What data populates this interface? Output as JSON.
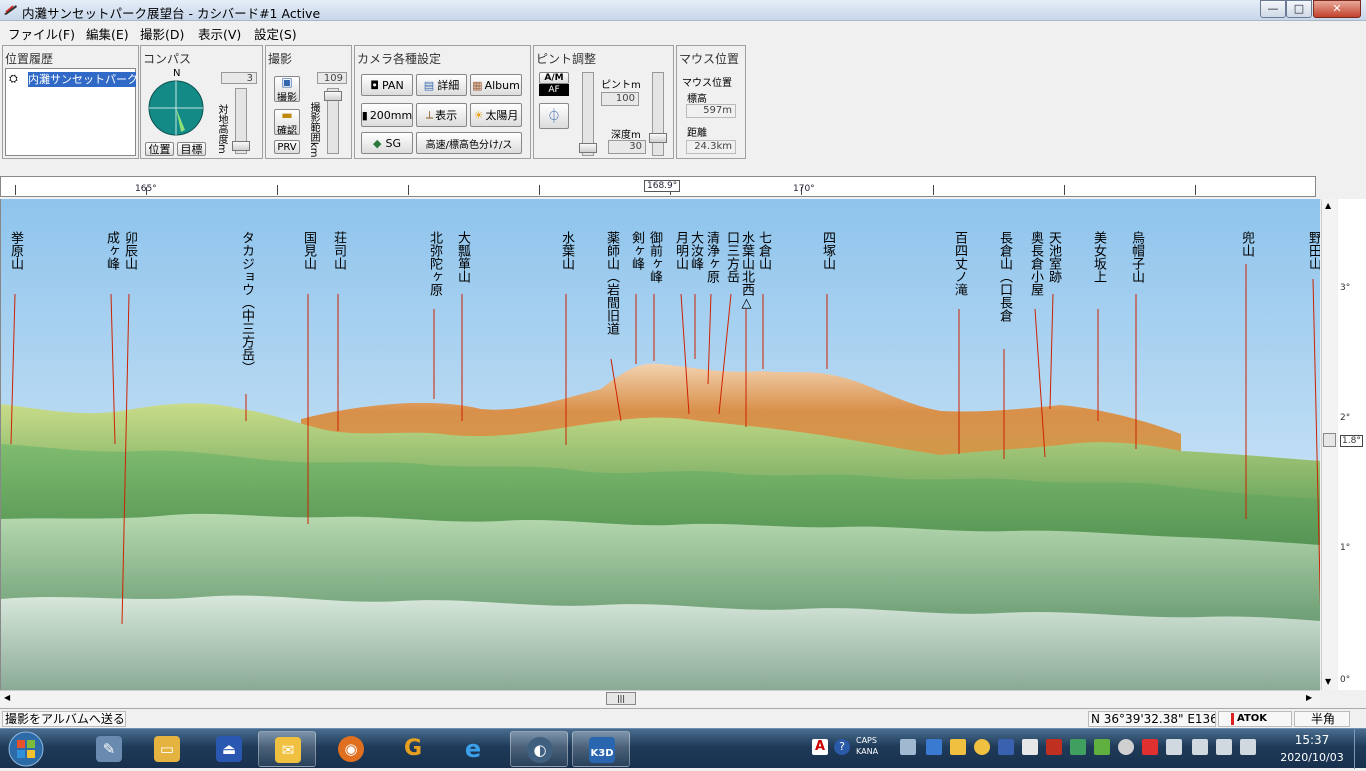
{
  "window": {
    "title": "内灘サンセットパーク展望台 - カシバード#1 Active",
    "min": "—",
    "max": "□",
    "close": "✕"
  },
  "menus": [
    "ファイル(F)",
    "編集(E)",
    "撮影(D)",
    "表示(V)",
    "設定(S)"
  ],
  "panels": {
    "history": {
      "title": "位置履歴",
      "item": "内灘サンセットパーク展"
    },
    "compass": {
      "title": "コンパス",
      "north": "N",
      "height_value": "3",
      "height_label": "対地高度m",
      "pos_button": "位置",
      "target_button": "目標"
    },
    "shoot": {
      "title": "撮影",
      "shoot_button": "撮影",
      "confirm_button": "確認",
      "prv_button": "PRV",
      "range_value": "109",
      "range_label": "撮影範囲km"
    },
    "camera": {
      "title": "カメラ各種設定",
      "buttons": [
        "PAN",
        "詳細",
        "Album",
        "200mm",
        "表示",
        "太陽月",
        "SG",
        "高速/標高色分け/ス"
      ]
    },
    "focus": {
      "title": "ピント調整",
      "am": "A/M",
      "af": "AF",
      "pinto_label": "ピントm",
      "pinto_value": "100",
      "depth_label": "深度m",
      "depth_value": "30"
    },
    "mouse": {
      "title": "マウス位置",
      "elev_label": "標高",
      "elev_value": "597m",
      "dist_label": "距離",
      "dist_value": "24.3km"
    }
  },
  "ruler": {
    "labels": [
      "165°",
      "168.9°",
      "170°"
    ]
  },
  "elevation_scale": {
    "labels": [
      "3°",
      "2°",
      "1.8°",
      "1°",
      "0°"
    ]
  },
  "peaks": [
    "挙原山",
    "卯辰山",
    "成ヶ峰",
    "タカジョウ（中三方岳）",
    "国見山",
    "荘司山",
    "北弥陀ヶ原",
    "大瓢箪山",
    "水葉山",
    "薬師山（岩間旧道",
    "剣ヶ峰",
    "御前ヶ峰",
    "月明山",
    "大汝峰",
    "清浄ヶ原",
    "口三方岳",
    "水葉山北西△",
    "七倉山",
    "四塚山",
    "百四丈ノ滝",
    "長倉山（口長倉",
    "奥長倉小屋",
    "天池室跡",
    "美女坂上",
    "烏帽子山",
    "兜山",
    "野田山"
  ],
  "colors": {
    "sky_top": "#8fc4ec",
    "sky_bottom": "#e8f3fb",
    "marker": "#cc2200",
    "ridge_green": "#5a9e55",
    "ridge_orange": "#d89a55"
  },
  "status": {
    "message": "撮影をアルバムへ送る",
    "coords": "N 36°39'32.38\"  E136",
    "ime": "ATOK",
    "ime_mode": "半角"
  },
  "taskbar": {
    "apps": [
      "explorer-icon",
      "folder-icon",
      "app-icon",
      "mail-icon",
      "firefox-icon",
      "google-icon",
      "ie-icon",
      "media-icon",
      "k3d-icon"
    ],
    "k3d_label": "K3D",
    "caps": "CAPS",
    "kana": "KANA",
    "time": "15:37",
    "date": "2020/10/03"
  }
}
